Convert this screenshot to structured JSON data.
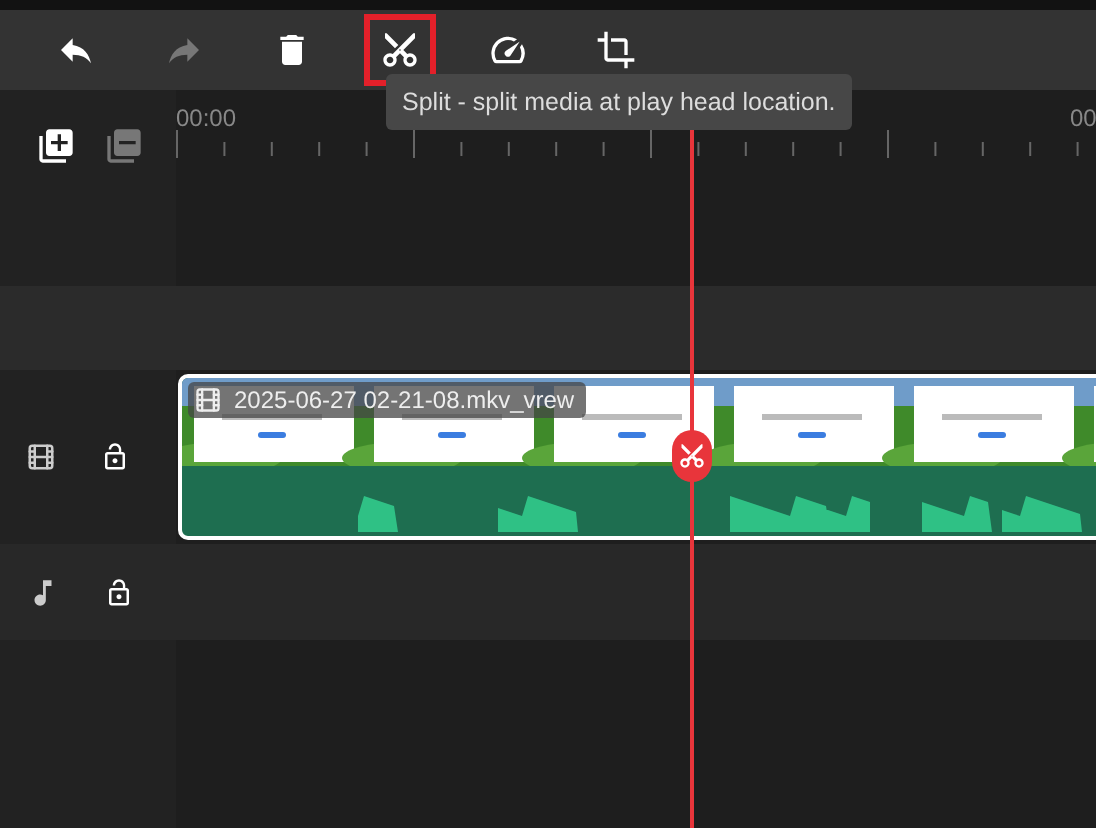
{
  "toolbar": {
    "buttons": [
      {
        "kind": "undo",
        "disabled": false,
        "selected": false
      },
      {
        "kind": "redo",
        "disabled": true,
        "selected": false
      },
      {
        "kind": "delete",
        "disabled": false,
        "selected": false
      },
      {
        "kind": "split",
        "disabled": false,
        "selected": true
      },
      {
        "kind": "speed",
        "disabled": false,
        "selected": false
      },
      {
        "kind": "crop",
        "disabled": false,
        "selected": false
      }
    ]
  },
  "tooltip": {
    "text": "Split - split media at play head location."
  },
  "track_controls": [
    {
      "kind": "add-track",
      "disabled": false
    },
    {
      "kind": "remove-track",
      "disabled": true
    }
  ],
  "ruler": {
    "labels": [
      "00:00",
      "00"
    ]
  },
  "tracks": [
    {
      "kind": "empty"
    },
    {
      "kind": "empty"
    },
    {
      "kind": "video",
      "locked": false,
      "clip": {
        "name": "2025-06-27 02-21-08.mkv_vrew"
      }
    },
    {
      "kind": "audio",
      "locked": false
    }
  ]
}
